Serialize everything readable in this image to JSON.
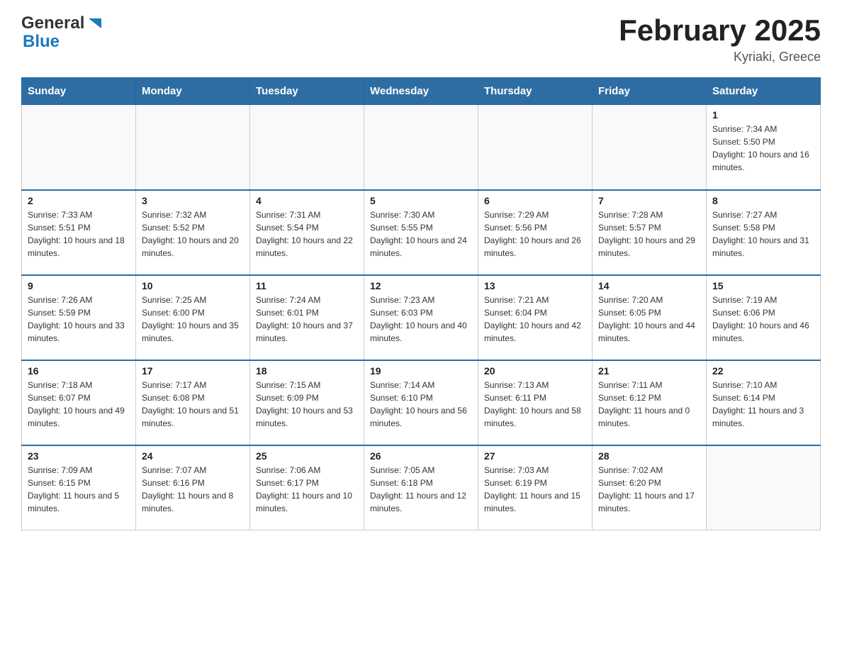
{
  "header": {
    "logo_general": "General",
    "logo_blue": "Blue",
    "month_year": "February 2025",
    "location": "Kyriaki, Greece"
  },
  "days_of_week": [
    "Sunday",
    "Monday",
    "Tuesday",
    "Wednesday",
    "Thursday",
    "Friday",
    "Saturday"
  ],
  "weeks": [
    [
      {
        "day": "",
        "info": ""
      },
      {
        "day": "",
        "info": ""
      },
      {
        "day": "",
        "info": ""
      },
      {
        "day": "",
        "info": ""
      },
      {
        "day": "",
        "info": ""
      },
      {
        "day": "",
        "info": ""
      },
      {
        "day": "1",
        "info": "Sunrise: 7:34 AM\nSunset: 5:50 PM\nDaylight: 10 hours and 16 minutes."
      }
    ],
    [
      {
        "day": "2",
        "info": "Sunrise: 7:33 AM\nSunset: 5:51 PM\nDaylight: 10 hours and 18 minutes."
      },
      {
        "day": "3",
        "info": "Sunrise: 7:32 AM\nSunset: 5:52 PM\nDaylight: 10 hours and 20 minutes."
      },
      {
        "day": "4",
        "info": "Sunrise: 7:31 AM\nSunset: 5:54 PM\nDaylight: 10 hours and 22 minutes."
      },
      {
        "day": "5",
        "info": "Sunrise: 7:30 AM\nSunset: 5:55 PM\nDaylight: 10 hours and 24 minutes."
      },
      {
        "day": "6",
        "info": "Sunrise: 7:29 AM\nSunset: 5:56 PM\nDaylight: 10 hours and 26 minutes."
      },
      {
        "day": "7",
        "info": "Sunrise: 7:28 AM\nSunset: 5:57 PM\nDaylight: 10 hours and 29 minutes."
      },
      {
        "day": "8",
        "info": "Sunrise: 7:27 AM\nSunset: 5:58 PM\nDaylight: 10 hours and 31 minutes."
      }
    ],
    [
      {
        "day": "9",
        "info": "Sunrise: 7:26 AM\nSunset: 5:59 PM\nDaylight: 10 hours and 33 minutes."
      },
      {
        "day": "10",
        "info": "Sunrise: 7:25 AM\nSunset: 6:00 PM\nDaylight: 10 hours and 35 minutes."
      },
      {
        "day": "11",
        "info": "Sunrise: 7:24 AM\nSunset: 6:01 PM\nDaylight: 10 hours and 37 minutes."
      },
      {
        "day": "12",
        "info": "Sunrise: 7:23 AM\nSunset: 6:03 PM\nDaylight: 10 hours and 40 minutes."
      },
      {
        "day": "13",
        "info": "Sunrise: 7:21 AM\nSunset: 6:04 PM\nDaylight: 10 hours and 42 minutes."
      },
      {
        "day": "14",
        "info": "Sunrise: 7:20 AM\nSunset: 6:05 PM\nDaylight: 10 hours and 44 minutes."
      },
      {
        "day": "15",
        "info": "Sunrise: 7:19 AM\nSunset: 6:06 PM\nDaylight: 10 hours and 46 minutes."
      }
    ],
    [
      {
        "day": "16",
        "info": "Sunrise: 7:18 AM\nSunset: 6:07 PM\nDaylight: 10 hours and 49 minutes."
      },
      {
        "day": "17",
        "info": "Sunrise: 7:17 AM\nSunset: 6:08 PM\nDaylight: 10 hours and 51 minutes."
      },
      {
        "day": "18",
        "info": "Sunrise: 7:15 AM\nSunset: 6:09 PM\nDaylight: 10 hours and 53 minutes."
      },
      {
        "day": "19",
        "info": "Sunrise: 7:14 AM\nSunset: 6:10 PM\nDaylight: 10 hours and 56 minutes."
      },
      {
        "day": "20",
        "info": "Sunrise: 7:13 AM\nSunset: 6:11 PM\nDaylight: 10 hours and 58 minutes."
      },
      {
        "day": "21",
        "info": "Sunrise: 7:11 AM\nSunset: 6:12 PM\nDaylight: 11 hours and 0 minutes."
      },
      {
        "day": "22",
        "info": "Sunrise: 7:10 AM\nSunset: 6:14 PM\nDaylight: 11 hours and 3 minutes."
      }
    ],
    [
      {
        "day": "23",
        "info": "Sunrise: 7:09 AM\nSunset: 6:15 PM\nDaylight: 11 hours and 5 minutes."
      },
      {
        "day": "24",
        "info": "Sunrise: 7:07 AM\nSunset: 6:16 PM\nDaylight: 11 hours and 8 minutes."
      },
      {
        "day": "25",
        "info": "Sunrise: 7:06 AM\nSunset: 6:17 PM\nDaylight: 11 hours and 10 minutes."
      },
      {
        "day": "26",
        "info": "Sunrise: 7:05 AM\nSunset: 6:18 PM\nDaylight: 11 hours and 12 minutes."
      },
      {
        "day": "27",
        "info": "Sunrise: 7:03 AM\nSunset: 6:19 PM\nDaylight: 11 hours and 15 minutes."
      },
      {
        "day": "28",
        "info": "Sunrise: 7:02 AM\nSunset: 6:20 PM\nDaylight: 11 hours and 17 minutes."
      },
      {
        "day": "",
        "info": ""
      }
    ]
  ]
}
